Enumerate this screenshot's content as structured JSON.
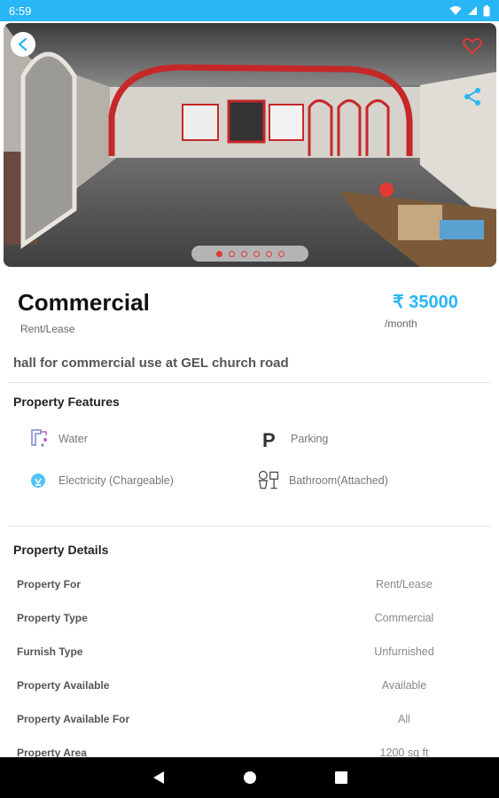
{
  "status_bar": {
    "time": "6:59"
  },
  "gallery": {
    "image_count": 6,
    "active_index": 0,
    "accent_color": "#e53935"
  },
  "listing": {
    "title": "Commercial",
    "subtitle": "Rent/Lease",
    "price": "₹ 35000",
    "price_unit": "/month",
    "description": "hall for commercial use at GEL church road"
  },
  "features": {
    "heading": "Property Features",
    "items": [
      {
        "label": "Water",
        "icon": "water-tap-icon"
      },
      {
        "label": "Parking",
        "icon": "parking-icon"
      },
      {
        "label": "Electricity (Chargeable)",
        "icon": "electricity-bulb-icon"
      },
      {
        "label": "Bathroom(Attached)",
        "icon": "bathroom-icon"
      }
    ]
  },
  "details": {
    "heading": "Property Details",
    "rows": [
      {
        "key": "Property For",
        "value": "Rent/Lease"
      },
      {
        "key": "Property Type",
        "value": "Commercial"
      },
      {
        "key": "Furnish Type",
        "value": "Unfurnished"
      },
      {
        "key": "Property Available",
        "value": "Available"
      },
      {
        "key": "Property Available For",
        "value": "All"
      },
      {
        "key": "Property Area",
        "value": "1200 sq ft"
      }
    ]
  },
  "colors": {
    "status_bar": "#29b6f6",
    "price": "#29b6f6",
    "favorite": "#e53935"
  }
}
